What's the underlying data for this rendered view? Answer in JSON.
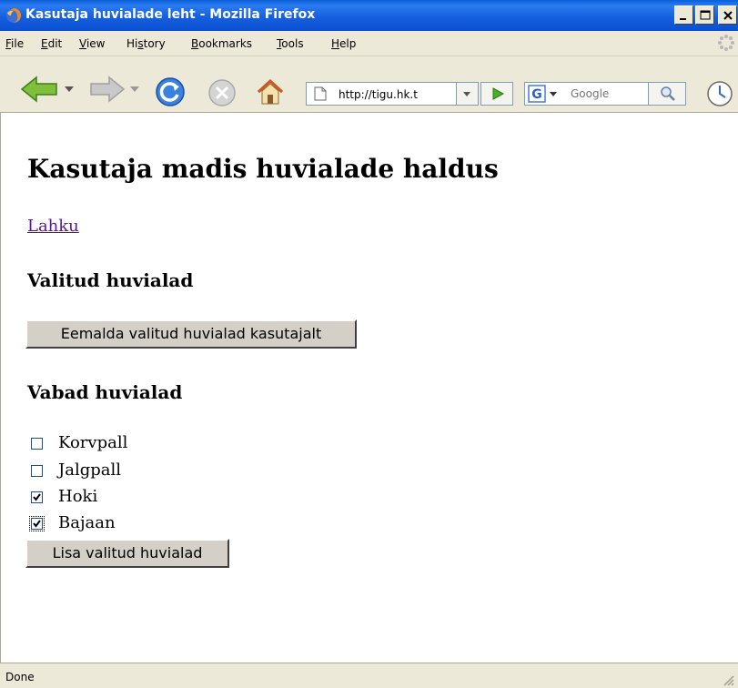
{
  "window": {
    "title": "Kasutaja huvialade leht - Mozilla Firefox"
  },
  "menu": {
    "items": [
      {
        "label": "File",
        "u": "F",
        "rest": "ile"
      },
      {
        "label": "Edit",
        "u": "E",
        "rest": "dit"
      },
      {
        "label": "View",
        "u": "V",
        "rest": "iew"
      },
      {
        "label": "History",
        "pre": "Hi",
        "u": "s",
        "rest": "tory"
      },
      {
        "label": "Bookmarks",
        "u": "B",
        "rest": "ookmarks"
      },
      {
        "label": "Tools",
        "u": "T",
        "rest": "ools"
      },
      {
        "label": "Help",
        "u": "H",
        "rest": "elp"
      }
    ]
  },
  "toolbar": {
    "url": "http://tigu.hk.t",
    "search_placeholder": "Google"
  },
  "page": {
    "heading": "Kasutaja madis huvialade haldus",
    "logout_link": "Lahku",
    "selected_heading": "Valitud huvialad",
    "remove_button": "Eemalda valitud huvialad kasutajalt",
    "free_heading": "Vabad huvialad",
    "interests": [
      {
        "label": "Korvpall",
        "checked": false
      },
      {
        "label": "Jalgpall",
        "checked": false
      },
      {
        "label": "Hoki",
        "checked": true
      },
      {
        "label": "Bajaan",
        "checked": true
      }
    ],
    "add_button": "Lisa valitud huvialad"
  },
  "statusbar": {
    "text": "Done"
  },
  "colors": {
    "titlebar": "#0b4fd0",
    "chrome": "#ece9d8",
    "link_visited": "#551a8b",
    "content_bg": "#ffffff"
  },
  "icons": [
    "firefox-icon",
    "minimize-icon",
    "maximize-icon",
    "close-icon",
    "throbber-icon",
    "back-icon",
    "forward-icon",
    "reload-icon",
    "stop-icon",
    "home-icon",
    "page-icon",
    "dropdown-icon",
    "go-icon",
    "google-icon",
    "search-icon",
    "clock-icon",
    "resize-grip-icon"
  ]
}
